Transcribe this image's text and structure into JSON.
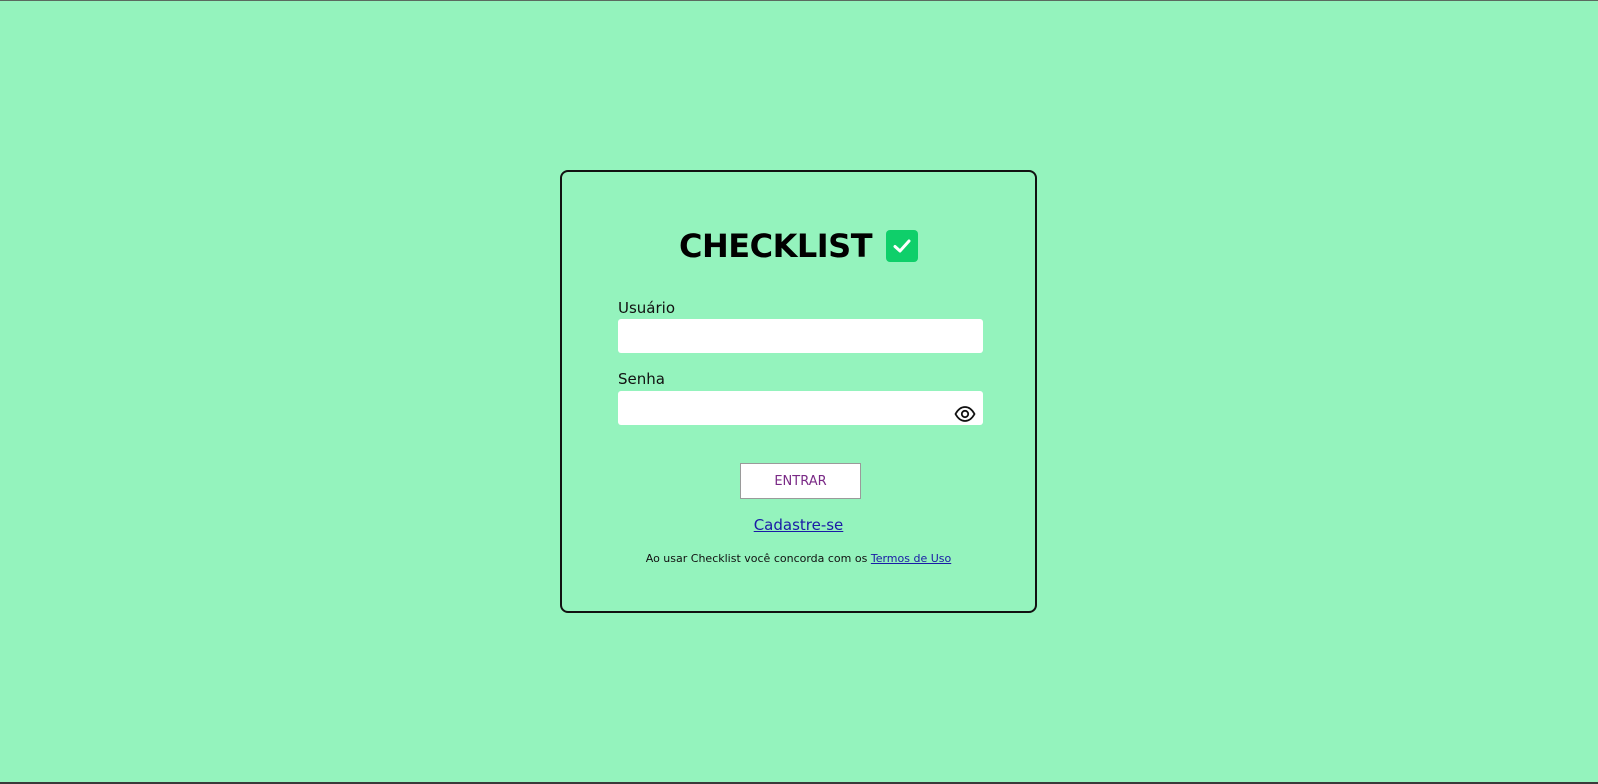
{
  "app": {
    "brand_title": "CHECKLIST",
    "brand_icon": "check-square-icon",
    "accent_color": "#0fcf6a",
    "background_color": "#94f3bd"
  },
  "login_form": {
    "username_label": "Usuário",
    "username_value": "",
    "password_label": "Senha",
    "password_value": "",
    "password_toggle_icon": "eye-icon",
    "submit_label": "ENTRAR",
    "signup_link": "Cadastre-se",
    "terms_prefix": "Ao usar Checklist você concorda com os",
    "terms_link": "Termos de Uso"
  }
}
